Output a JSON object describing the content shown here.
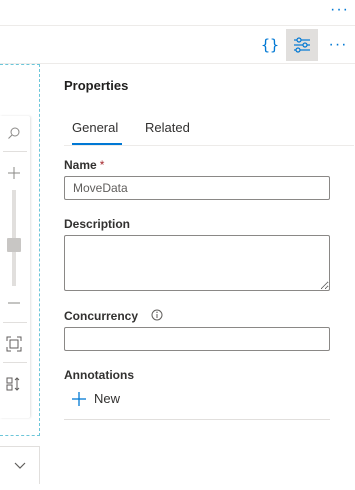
{
  "topbar": {
    "more_icon": "more-horizontal-icon",
    "more_glyph": "···"
  },
  "toolbar": {
    "code_icon": "code-braces-icon",
    "code_glyph": "{}",
    "properties_icon": "properties-sliders-icon",
    "more_icon": "more-horizontal-icon",
    "more_glyph": "···"
  },
  "canvas": {
    "icons": [
      "search-icon",
      "zoom-in-icon",
      "zoom-out-icon",
      "fit-to-screen-icon",
      "auto-align-icon",
      "chevron-down-icon"
    ],
    "zoom_level": 0.5
  },
  "properties": {
    "title": "Properties",
    "tabs": [
      {
        "label": "General",
        "active": true
      },
      {
        "label": "Related",
        "active": false
      }
    ],
    "name_label": "Name",
    "required_mark": "*",
    "name_value": "MoveData",
    "description_label": "Description",
    "description_value": "",
    "concurrency_label": "Concurrency",
    "concurrency_value": "",
    "annotations_label": "Annotations",
    "new_label": "New"
  },
  "colors": {
    "accent": "#0078d4",
    "required": "#a4262c",
    "canvas_border": "#6cc6d9"
  }
}
